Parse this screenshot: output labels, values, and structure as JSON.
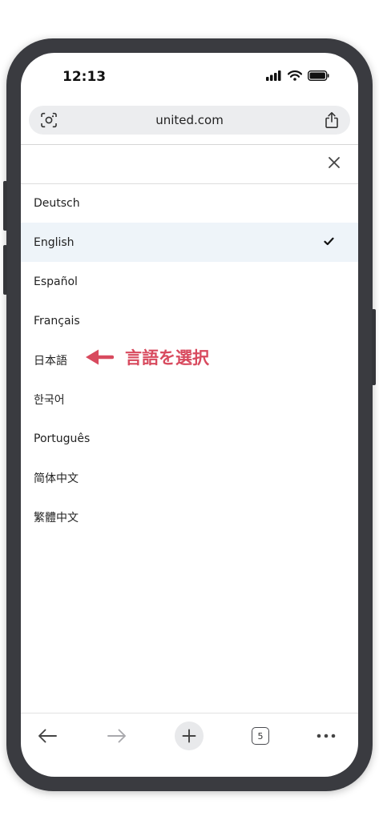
{
  "status_bar": {
    "time": "12:13"
  },
  "browser": {
    "url": "united.com"
  },
  "language_menu": {
    "items": [
      {
        "label": "Deutsch"
      },
      {
        "label": "English",
        "selected": true
      },
      {
        "label": "Español"
      },
      {
        "label": "Français"
      },
      {
        "label": "日本語"
      },
      {
        "label": "한국어"
      },
      {
        "label": "Português"
      },
      {
        "label": "简体中文"
      },
      {
        "label": "繁體中文"
      }
    ]
  },
  "annotation": {
    "text": "言語を選択",
    "color": "#d84a5e"
  },
  "toolbar": {
    "tab_count": "5"
  },
  "colors": {
    "frame": "#3a3b40",
    "selected_row": "#eef4f9",
    "accent": "#d84a5e"
  },
  "icons": [
    "camera-lens-icon",
    "share-icon",
    "close-icon",
    "checkmark-icon",
    "arrow-left-icon",
    "back-arrow-icon",
    "forward-arrow-icon",
    "plus-icon",
    "tabs-icon",
    "more-icon",
    "signal-icon",
    "wifi-icon",
    "battery-icon"
  ]
}
